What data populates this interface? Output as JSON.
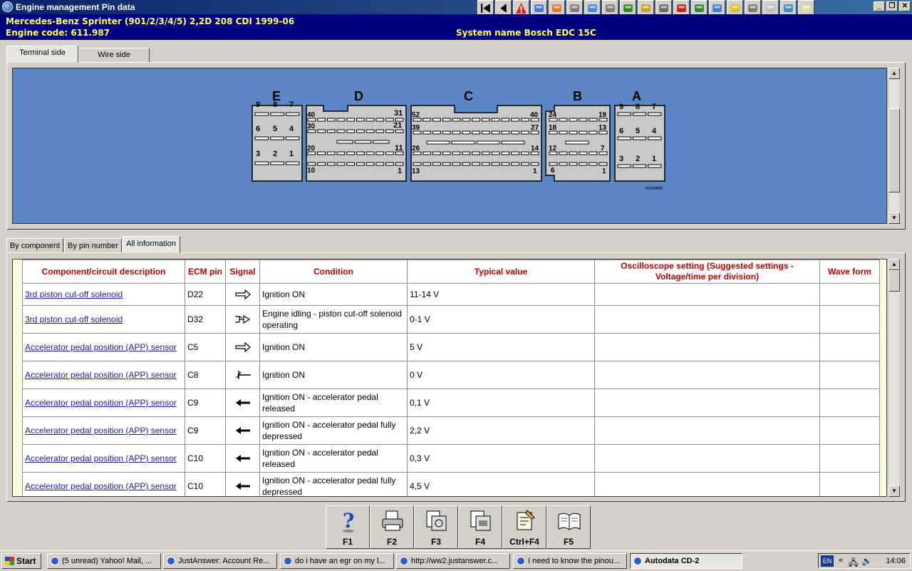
{
  "window": {
    "title": "Engine management Pin data"
  },
  "toolbar": {
    "icons": [
      "first-page-icon",
      "back-icon",
      "warning-icon",
      "diagram-icon",
      "component-icon",
      "wiring-icon",
      "gauge-icon",
      "tools-icon",
      "settings-icon",
      "print-icon",
      "engine-icon",
      "spanner-icon",
      "car-icon",
      "cable-icon",
      "face-icon",
      "wrench-icon",
      "lamp-icon",
      "reset-icon",
      "note-icon"
    ]
  },
  "header": {
    "vehicle": "Mercedes-Benz   Sprinter (901/2/3/4/5) 2,2D 208 CDI 1999-06",
    "engine_code": "Engine code: 611.987",
    "system_name": "System name Bosch EDC 15C"
  },
  "view_tabs": {
    "terminal_side": "Terminal side",
    "wire_side": "Wire side"
  },
  "connectors": {
    "E": {
      "label": "E",
      "pins": [
        "9",
        "8",
        "7",
        "6",
        "5",
        "4",
        "3",
        "2",
        "1"
      ]
    },
    "D": {
      "label": "D",
      "pins": [
        "40",
        "31",
        "30",
        "21",
        "20",
        "11",
        "10",
        "1"
      ]
    },
    "C": {
      "label": "C",
      "pins": [
        "52",
        "40",
        "39",
        "27",
        "26",
        "14",
        "13",
        "1"
      ]
    },
    "B": {
      "label": "B",
      "pins": [
        "24",
        "19",
        "18",
        "13",
        "12",
        "7",
        "6",
        "1"
      ]
    },
    "A": {
      "label": "A",
      "pins": [
        "9",
        "8",
        "7",
        "6",
        "5",
        "4",
        "3",
        "2",
        "1"
      ]
    },
    "ref": "A043686"
  },
  "info_tabs": {
    "by_component": "By component",
    "by_pin": "By pin number",
    "all_info": "All information"
  },
  "table": {
    "headers": {
      "component": "Component/circuit description",
      "ecm_pin": "ECM pin",
      "signal": "Signal",
      "condition": "Condition",
      "typical": "Typical value",
      "oscilloscope": "Oscilloscope setting (Suggested settings - Voltage/time per division)",
      "waveform": "Wave form"
    },
    "rows": [
      {
        "component": "3rd piston cut-off solenoid",
        "pin": "D22",
        "signal": "output-arrow-icon",
        "condition": "Ignition ON",
        "value": "11-14 V"
      },
      {
        "component": "3rd piston cut-off solenoid",
        "pin": "D32",
        "signal": "switched-output-icon",
        "condition": "Engine idling - piston cut-off solenoid operating",
        "value": "0-1 V"
      },
      {
        "component": "Accelerator pedal position (APP) sensor",
        "pin": "C5",
        "signal": "output-arrow-icon",
        "condition": "Ignition ON",
        "value": "5 V"
      },
      {
        "component": "Accelerator pedal position (APP) sensor",
        "pin": "C8",
        "signal": "ground-icon",
        "condition": "Ignition ON",
        "value": "0 V"
      },
      {
        "component": "Accelerator pedal position (APP) sensor",
        "pin": "C9",
        "signal": "input-arrow-icon",
        "condition": "Ignition ON - accelerator pedal released",
        "value": "0,1 V"
      },
      {
        "component": "Accelerator pedal position (APP) sensor",
        "pin": "C9",
        "signal": "input-arrow-icon",
        "condition": "Ignition ON - accelerator pedal fully depressed",
        "value": "2,2 V"
      },
      {
        "component": "Accelerator pedal position (APP) sensor",
        "pin": "C10",
        "signal": "input-arrow-icon",
        "condition": "Ignition ON - accelerator pedal released",
        "value": "0,3 V"
      },
      {
        "component": "Accelerator pedal position (APP) sensor",
        "pin": "C10",
        "signal": "input-arrow-icon",
        "condition": "Ignition ON - accelerator pedal fully depressed",
        "value": "4,5 V"
      }
    ]
  },
  "fkeys": [
    {
      "label": "F1",
      "icon": "help-icon"
    },
    {
      "label": "F2",
      "icon": "print-icon"
    },
    {
      "label": "F3",
      "icon": "print-preview-icon"
    },
    {
      "label": "F4",
      "icon": "print-all-icon"
    },
    {
      "label": "Ctrl+F4",
      "icon": "note-edit-icon"
    },
    {
      "label": "F5",
      "icon": "book-icon"
    }
  ],
  "taskbar": {
    "start": "Start",
    "tasks": [
      "(5 unread) Yahoo! Mail, ...",
      "JustAnswer: Account Re...",
      "do i have an egr on my l...",
      "http://ww2.justanswer.c...",
      "I need to know the pinou...",
      "Autodata CD-2"
    ],
    "lang": "EN",
    "clock": "14:06"
  }
}
